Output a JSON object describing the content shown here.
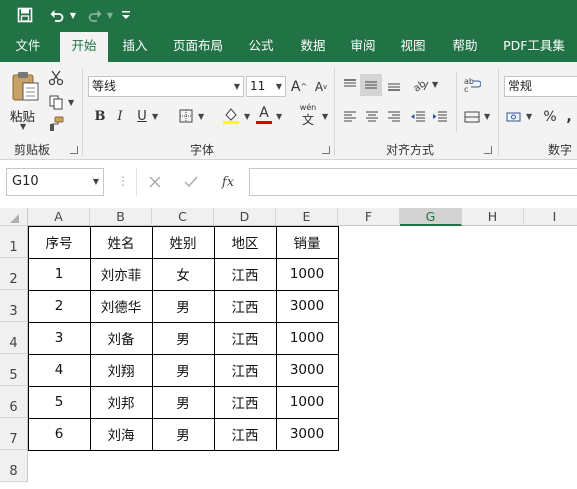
{
  "quick_access": {
    "save": "save-icon",
    "undo": "undo-icon",
    "redo": "redo-icon",
    "customize": "customize-icon"
  },
  "tabs": [
    "文件",
    "开始",
    "插入",
    "页面布局",
    "公式",
    "数据",
    "审阅",
    "视图",
    "帮助",
    "PDF工具集"
  ],
  "ribbon": {
    "clipboard": {
      "paste_label": "粘贴",
      "group_label": "剪贴板"
    },
    "font": {
      "font_name": "等线",
      "font_size": "11",
      "group_label": "字体",
      "wen_label": "wén",
      "wen_char": "文"
    },
    "alignment": {
      "group_label": "对齐方式"
    },
    "number": {
      "format": "常规",
      "group_label": "数字",
      "percent": "%",
      "comma": ","
    }
  },
  "formula_bar": {
    "name_box": "G10",
    "fx_label": "fx",
    "formula": ""
  },
  "columns": [
    "A",
    "B",
    "C",
    "D",
    "E",
    "F",
    "G",
    "H",
    "I"
  ],
  "rows": [
    "1",
    "2",
    "3",
    "4",
    "5",
    "6",
    "7",
    "8"
  ],
  "table": {
    "headers": [
      "序号",
      "姓名",
      "姓别",
      "地区",
      "销量"
    ],
    "rows": [
      [
        "1",
        "刘亦菲",
        "女",
        "江西",
        "1000"
      ],
      [
        "2",
        "刘德华",
        "男",
        "江西",
        "3000"
      ],
      [
        "3",
        "刘备",
        "男",
        "江西",
        "1000"
      ],
      [
        "4",
        "刘翔",
        "男",
        "江西",
        "3000"
      ],
      [
        "5",
        "刘邦",
        "男",
        "江西",
        "1000"
      ],
      [
        "6",
        "刘海",
        "男",
        "江西",
        "3000"
      ]
    ]
  },
  "colors": {
    "brand": "#217346",
    "ribbon_bg": "#f3f3f3",
    "header_bg": "#f0f0f0",
    "font_color": "#e00000",
    "highlight": "#ffff00"
  }
}
